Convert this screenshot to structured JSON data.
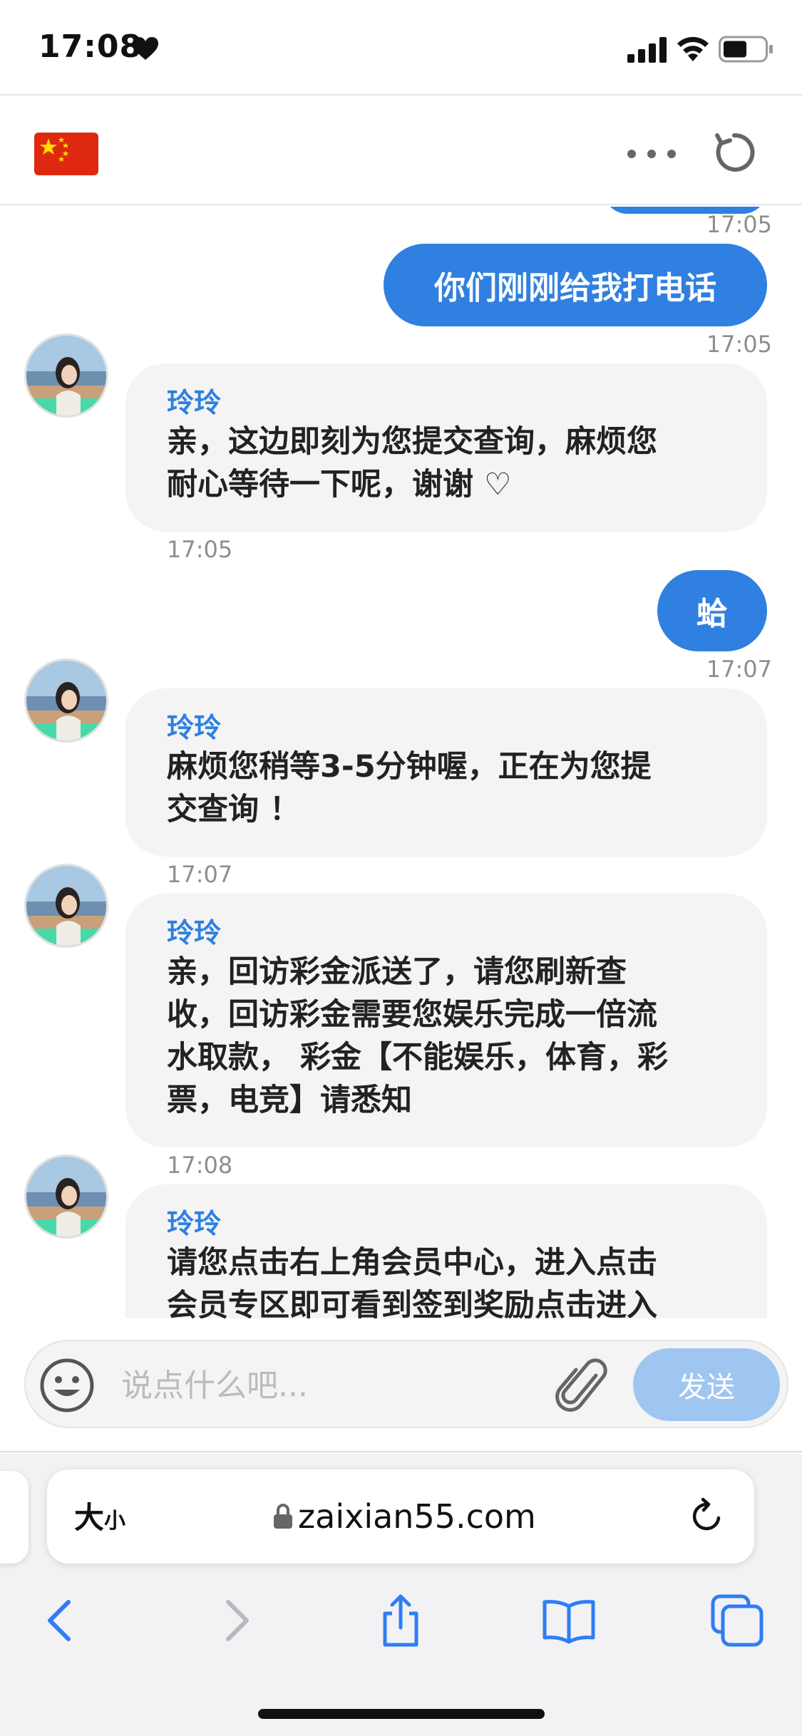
{
  "status_bar": {
    "time": "17:08",
    "heart_icon": "heart-icon",
    "signal_icon": "cellular-signal-icon",
    "wifi_icon": "wifi-icon",
    "battery_icon": "battery-icon"
  },
  "header": {
    "flag_icon": "china-flag-icon",
    "more_icon": "more-dots-icon",
    "refresh_icon": "refresh-icon"
  },
  "messages": [
    {
      "direction": "out",
      "text": "",
      "time": "17:05"
    },
    {
      "direction": "out",
      "text": "你们刚刚给我打电话",
      "time": "17:05"
    },
    {
      "direction": "in",
      "sender": "玲玲",
      "lines": [
        "亲，这边即刻为您提交查询，麻烦您",
        "耐心等待一下呢，谢谢 ♡"
      ],
      "time": "17:05"
    },
    {
      "direction": "out",
      "text": "蛤",
      "time": "17:07"
    },
    {
      "direction": "in",
      "sender": "玲玲",
      "lines": [
        "麻烦您稍等3-5分钟喔，正在为您提",
        "交查询 ！"
      ],
      "time": "17:07"
    },
    {
      "direction": "in",
      "sender": "玲玲",
      "lines": [
        "亲，回访彩金派送了，请您刷新查",
        "收，回访彩金需要您娱乐完成一倍流",
        "水取款， 彩金【不能娱乐，体育，彩",
        "票，电竞】请悉知"
      ],
      "time": "17:08"
    },
    {
      "direction": "in",
      "sender": "玲玲",
      "lines": [
        "请您点击右上角会员中心，进入点击",
        "会员专区即可看到签到奖励点击进入"
      ]
    }
  ],
  "composer": {
    "placeholder": "说点什么吧...",
    "send_label": "发送"
  },
  "browser": {
    "text_size_label": "大",
    "text_size_small": "小",
    "url": "zaixian55.com"
  },
  "colors": {
    "accent": "#2f80e0",
    "send_disabled": "#9fc6f0",
    "incoming_bubble": "#f4f4f4"
  }
}
